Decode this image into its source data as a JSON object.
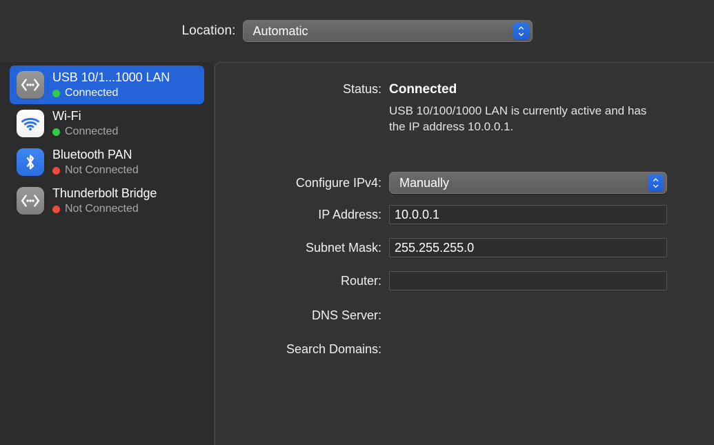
{
  "location_bar": {
    "label": "Location:",
    "selected": "Automatic",
    "stepper_icon": "chevron-up-down-icon"
  },
  "sidebar": {
    "services": [
      {
        "name": "USB 10/1...1000 LAN",
        "status": "Connected",
        "status_color": "#35c94a",
        "icon": "ethernet-icon",
        "selected": true
      },
      {
        "name": "Wi-Fi",
        "status": "Connected",
        "status_color": "#35c94a",
        "icon": "wifi-icon",
        "selected": false
      },
      {
        "name": "Bluetooth PAN",
        "status": "Not Connected",
        "status_color": "#ec4c3c",
        "icon": "bluetooth-icon",
        "selected": false
      },
      {
        "name": "Thunderbolt Bridge",
        "status": "Not Connected",
        "status_color": "#ec4c3c",
        "icon": "ethernet-icon",
        "selected": false
      }
    ]
  },
  "details": {
    "status_label": "Status:",
    "status_value": "Connected",
    "status_description": "USB 10/100/1000 LAN is currently active and has the IP address 10.0.0.1.",
    "configure_label": "Configure IPv4:",
    "configure_value": "Manually",
    "ip_label": "IP Address:",
    "ip_value": "10.0.0.1",
    "subnet_label": "Subnet Mask:",
    "subnet_value": "255.255.255.0",
    "router_label": "Router:",
    "router_value": "",
    "dns_label": "DNS Server:",
    "dns_value": "",
    "search_domains_label": "Search Domains:",
    "search_domains_value": "",
    "stepper_icon": "chevron-up-down-icon"
  },
  "colors": {
    "accent_blue": "#2463d8",
    "panel_bg": "#333333",
    "sidebar_bg": "#2c2c2c",
    "connected_green": "#35c94a",
    "disconnected_red": "#ec4c3c"
  }
}
